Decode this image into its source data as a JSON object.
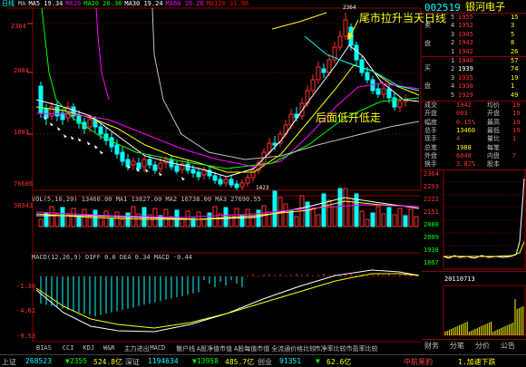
{
  "window": {
    "left_label": "日线"
  },
  "ma_legend": [
    {
      "text": "MA",
      "color": "#c0c0c0"
    },
    {
      "text": "MA5 19.34",
      "color": "#ffffff"
    },
    {
      "text": "MA10",
      "color": "#ff00ff"
    },
    {
      "text": "MA20 20.36",
      "color": "#00ff00"
    },
    {
      "text": "MA30 19.24",
      "color": "#ffffff"
    },
    {
      "text": "MA60 16.20",
      "color": "#ff00ff"
    },
    {
      "text": "MA120 31.90",
      "color": "#ff0000"
    }
  ],
  "price_axis": [
    "2364",
    "2084",
    "1803"
  ],
  "annotations": {
    "top": "尾市拉升当天日线",
    "mid": "后面低开低走",
    "high_mark": "2364",
    "low_mark": "1423"
  },
  "volume": {
    "legend": "VOL(5,10,20)  13460.00  MA1 13827.00  MA2 16738.00  MA3 27690.55",
    "axis": [
      "76686",
      "38343"
    ]
  },
  "macd": {
    "legend": "MACD(12,26,9)  DIFF 0.0  DEA 0.34  MACD -0.44",
    "axis": [
      "-1.30",
      "-4.61",
      "-9.53"
    ]
  },
  "bottom_tabs": [
    "BIAS",
    "CCI",
    "KDJ",
    "W&R",
    "主力进出",
    "MACD",
    "散户线",
    "A股净值市值",
    "A股每值市值",
    "全流通价格比较",
    "市净率比较",
    "市盈率比较"
  ],
  "quote": {
    "code": "002519",
    "name": "银河电子",
    "asks": [
      {
        "label": "5",
        "price": "1955",
        "vol": "15"
      },
      {
        "label": "4",
        "price": "1952",
        "vol": "3"
      },
      {
        "label": "3",
        "price": "1945",
        "vol": "5"
      },
      {
        "label": "2",
        "price": "1943",
        "vol": "8"
      },
      {
        "label": "1",
        "price": "1942",
        "vol": "26"
      }
    ],
    "ask_group_labels": [
      "卖",
      "盘"
    ],
    "bids": [
      {
        "label": "1",
        "price": "1940",
        "vol": "57"
      },
      {
        "label": "2",
        "price": "1939",
        "vol": "74"
      },
      {
        "label": "3",
        "price": "1935",
        "vol": "19"
      },
      {
        "label": "4",
        "price": "1930",
        "vol": "1"
      },
      {
        "label": "5",
        "price": "1929",
        "vol": "49"
      }
    ],
    "bid_group_labels": [
      "买",
      "盘"
    ],
    "stats": [
      {
        "k": "成交",
        "v": "1942",
        "k2": "均价",
        "v2": "19"
      },
      {
        "k": "开盘",
        "v": "003",
        "k2": "开盘",
        "v2": "19"
      },
      {
        "k": "幅度",
        "v": "0.15%",
        "k2": "最高",
        "v2": "19"
      },
      {
        "k": "总手",
        "v": "13460",
        "k2": "最低",
        "v2": "19"
      },
      {
        "k": "现手",
        "v": "4",
        "k2": "量比",
        "v2": "1"
      },
      {
        "k": "总笔",
        "v": "1988",
        "k2": "每笔",
        "v2": ""
      },
      {
        "k": "外盘",
        "v": "6048",
        "k2": "内盘",
        "v2": "7"
      },
      {
        "k": "换手",
        "v": "3.82%",
        "k2": "股本",
        "v2": ""
      }
    ],
    "intraday_axis": [
      "2364",
      "2293",
      "2222",
      "2151",
      "2080",
      "2009",
      "1938",
      "1867"
    ],
    "date": "20110713",
    "tabs": [
      "财务",
      "分笔",
      "分价",
      "公告"
    ]
  },
  "status_bar": [
    {
      "text": "上证",
      "color": "#c0c0c0"
    },
    {
      "text": "268523",
      "color": "#00ffff"
    },
    {
      "text": "▼2355",
      "color": "#00ff00"
    },
    {
      "text": "524.8亿",
      "color": "#ffff00"
    },
    {
      "text": "深证",
      "color": "#c0c0c0"
    },
    {
      "text": "1194634",
      "color": "#00ffff"
    },
    {
      "text": "▼13958",
      "color": "#00ff00"
    },
    {
      "text": "485.7亿",
      "color": "#ffff00"
    },
    {
      "text": "创业",
      "color": "#c0c0c0"
    },
    {
      "text": "91351",
      "color": "#00ffff"
    },
    {
      "text": "▼",
      "color": "#00ff00"
    },
    {
      "text": "62.6亿",
      "color": "#ffff00"
    },
    {
      "text": "中航黑豹",
      "color": "#ff4040"
    },
    {
      "text": "1.加速下跌",
      "color": "#ffff00"
    }
  ],
  "colors": {
    "up": "#ff3030",
    "down": "#00ffff",
    "yellow": "#ffff00",
    "white": "#ffffff",
    "green": "#00ff00",
    "magenta": "#ff00ff",
    "grid": "#8b0000"
  }
}
